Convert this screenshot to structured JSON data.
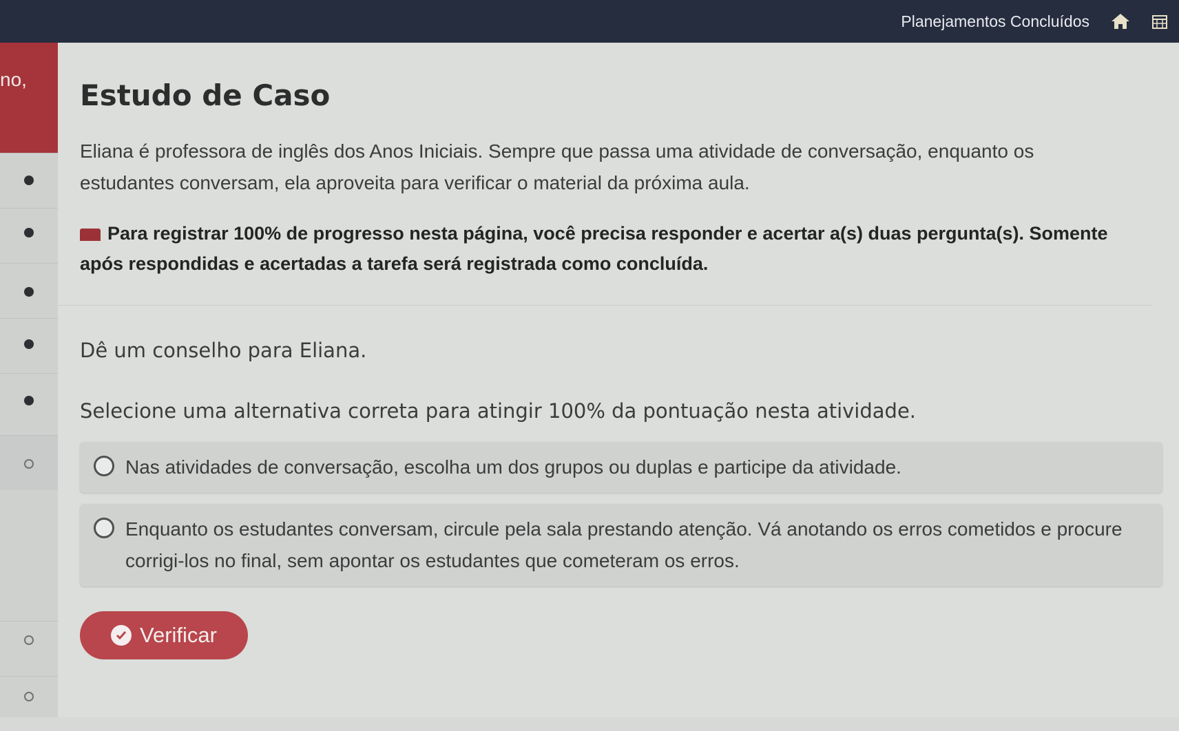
{
  "topbar": {
    "link_label": "Planejamentos Concluídos",
    "home_icon": "home-icon",
    "calendar_icon": "calendar-icon"
  },
  "sidebar": {
    "header_text": "no,",
    "items": [
      {
        "state": "filled"
      },
      {
        "state": "filled"
      },
      {
        "state": "filled"
      },
      {
        "state": "filled"
      },
      {
        "state": "filled"
      },
      {
        "state": "empty"
      },
      {
        "state": "empty"
      },
      {
        "state": "empty"
      }
    ]
  },
  "main": {
    "title": "Estudo de Caso",
    "paragraph": "Eliana é professora de inglês dos Anos Iniciais. Sempre que passa uma atividade de conversação, enquanto os estudantes conversam, ela aproveita para verificar o material da próxima aula.",
    "notice": "Para registrar 100% de progresso nesta página, você precisa responder e acertar a(s) duas pergunta(s). Somente após respondidas e acertadas a tarefa será registrada como concluída.",
    "question": "Dê um conselho para Eliana.",
    "instruction": "Selecione uma alternativa correta para atingir 100% da pontuação nesta atividade.",
    "options": [
      "Nas atividades de conversação, escolha um dos grupos ou duplas e participe da atividade.",
      "Enquanto os estudantes conversam, circule pela sala prestando atenção. Vá anotando os erros cometidos e procure corrigi-los no final, sem apontar os estudantes que cometeram os erros."
    ],
    "verify_label": "Verificar"
  },
  "colors": {
    "topbar": "#252d3e",
    "accent": "#a5353a",
    "button": "#b8464c"
  }
}
